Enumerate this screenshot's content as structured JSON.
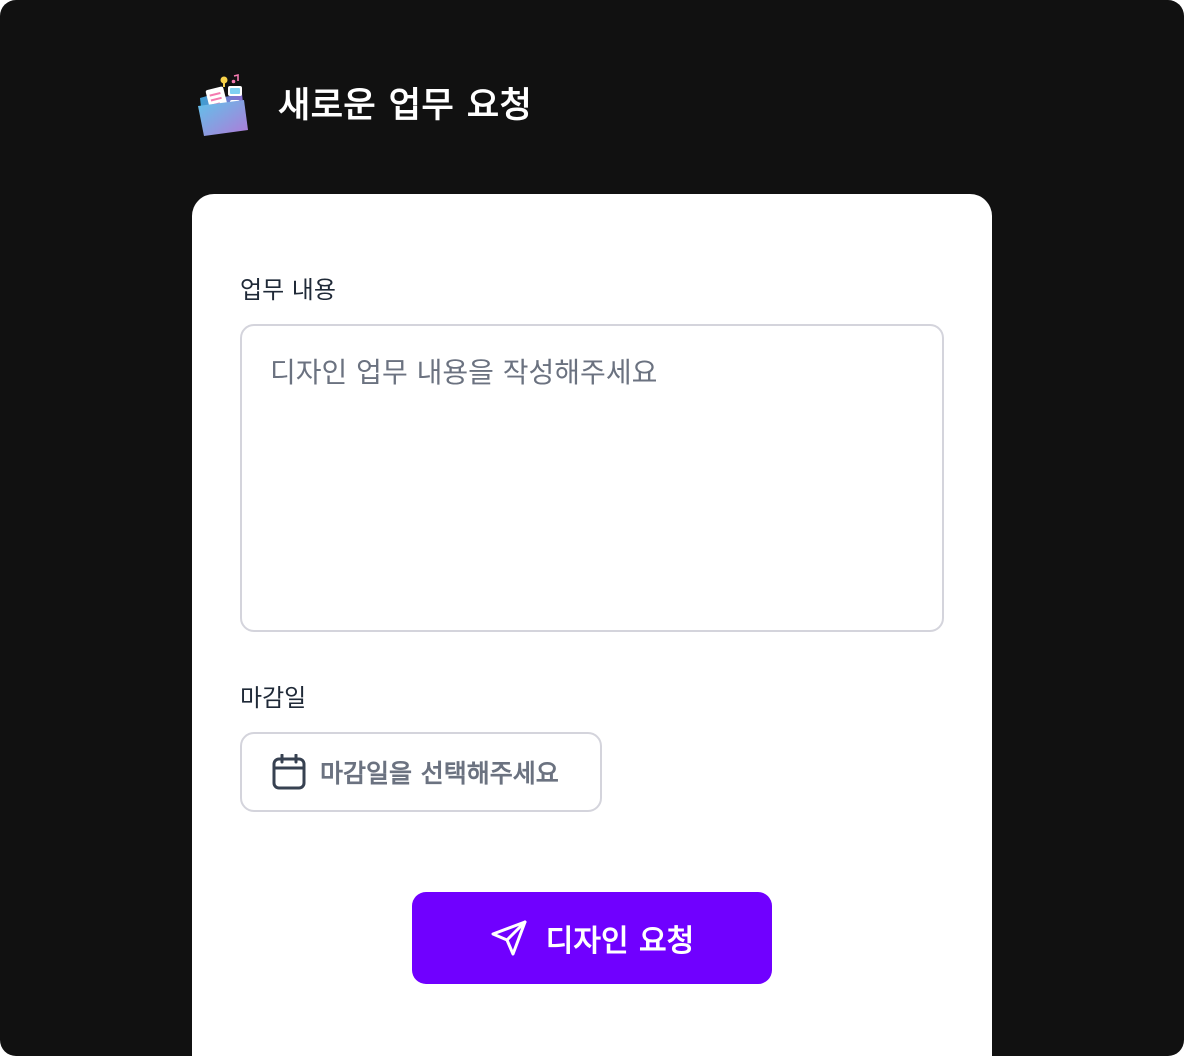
{
  "header": {
    "icon": "folder-icon",
    "title": "새로운 업무 요청"
  },
  "form": {
    "content_label": "업무 내용",
    "content_placeholder": "디자인 업무 내용을 작성해주세요",
    "content_value": "",
    "deadline_label": "마감일",
    "deadline_icon": "calendar-icon",
    "deadline_placeholder": "마감일을 선택해주세요",
    "submit_icon": "send-icon",
    "submit_label": "디자인 요청"
  },
  "colors": {
    "background": "#111111",
    "card": "#ffffff",
    "accent": "#7000ff",
    "placeholder": "#6b7280",
    "label": "#1f2937",
    "border": "#d4d4dc"
  }
}
